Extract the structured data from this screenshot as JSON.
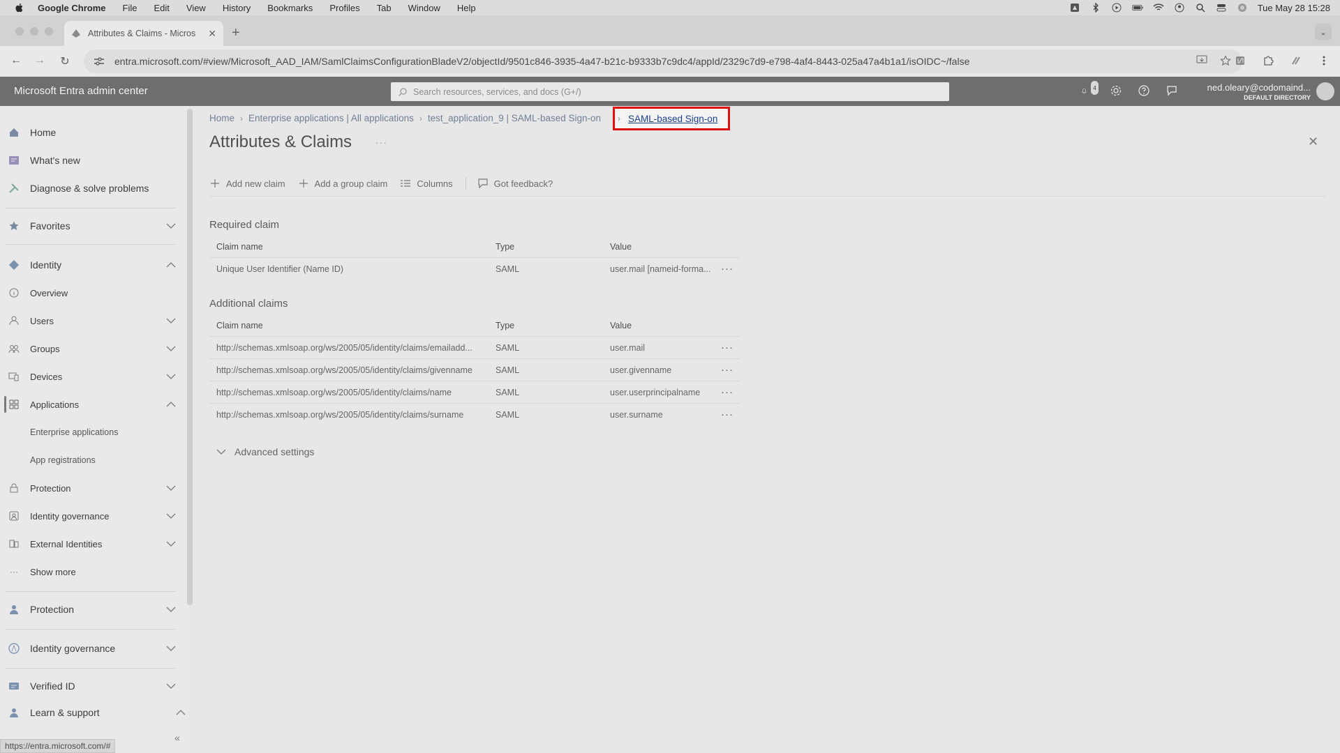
{
  "menubar": {
    "app": "Google Chrome",
    "items": [
      "File",
      "Edit",
      "View",
      "History",
      "Bookmarks",
      "Profiles",
      "Tab",
      "Window",
      "Help"
    ],
    "datetime": "Tue May 28  15:28"
  },
  "browser": {
    "tab_title": "Attributes & Claims - Micros",
    "url": "entra.microsoft.com/#view/Microsoft_AAD_IAM/SamlClaimsConfigurationBladeV2/objectId/9501c846-3935-4a47-b21c-b9333b7c9dc4/appId/2329c7d9-e798-4af4-8443-025a47a4b1a1/isOIDC~/false",
    "status_url": "https://entra.microsoft.com/#"
  },
  "header": {
    "title": "Microsoft Entra admin center",
    "search_placeholder": "Search resources, services, and docs (G+/)",
    "notifications_count": "4",
    "user_email": "ned.oleary@codomaind...",
    "directory": "DEFAULT DIRECTORY"
  },
  "sidebar": {
    "home": "Home",
    "whats_new": "What's new",
    "diagnose": "Diagnose & solve problems",
    "favorites": "Favorites",
    "identity": "Identity",
    "overview": "Overview",
    "users": "Users",
    "groups": "Groups",
    "devices": "Devices",
    "applications": "Applications",
    "enterprise_apps": "Enterprise applications",
    "app_registrations": "App registrations",
    "protection_sub": "Protection",
    "identity_governance_sub": "Identity governance",
    "external_identities": "External Identities",
    "show_more": "Show more",
    "protection": "Protection",
    "identity_governance": "Identity governance",
    "verified_id": "Verified ID",
    "learn_support": "Learn & support"
  },
  "breadcrumb": {
    "items": [
      "Home",
      "Enterprise applications | All applications",
      "test_application_9 | SAML-based Sign-on"
    ],
    "current": "SAML-based Sign-on"
  },
  "page": {
    "title": "Attributes & Claims",
    "more": "···"
  },
  "commands": {
    "add_claim": "Add new claim",
    "add_group_claim": "Add a group claim",
    "columns": "Columns",
    "feedback": "Got feedback?"
  },
  "required": {
    "title": "Required claim",
    "headers": [
      "Claim name",
      "Type",
      "Value"
    ],
    "rows": [
      {
        "name": "Unique User Identifier (Name ID)",
        "type": "SAML",
        "value": "user.mail [nameid-forma..."
      }
    ]
  },
  "additional": {
    "title": "Additional claims",
    "headers": [
      "Claim name",
      "Type",
      "Value"
    ],
    "rows": [
      {
        "name": "http://schemas.xmlsoap.org/ws/2005/05/identity/claims/emailadd...",
        "type": "SAML",
        "value": "user.mail"
      },
      {
        "name": "http://schemas.xmlsoap.org/ws/2005/05/identity/claims/givenname",
        "type": "SAML",
        "value": "user.givenname"
      },
      {
        "name": "http://schemas.xmlsoap.org/ws/2005/05/identity/claims/name",
        "type": "SAML",
        "value": "user.userprincipalname"
      },
      {
        "name": "http://schemas.xmlsoap.org/ws/2005/05/identity/claims/surname",
        "type": "SAML",
        "value": "user.surname"
      }
    ]
  },
  "row_menu": "···",
  "advanced": "Advanced settings",
  "colors": {
    "highlight": "#e01010",
    "link": "#1b3f8f",
    "header_bg": "#6e6e6e"
  }
}
